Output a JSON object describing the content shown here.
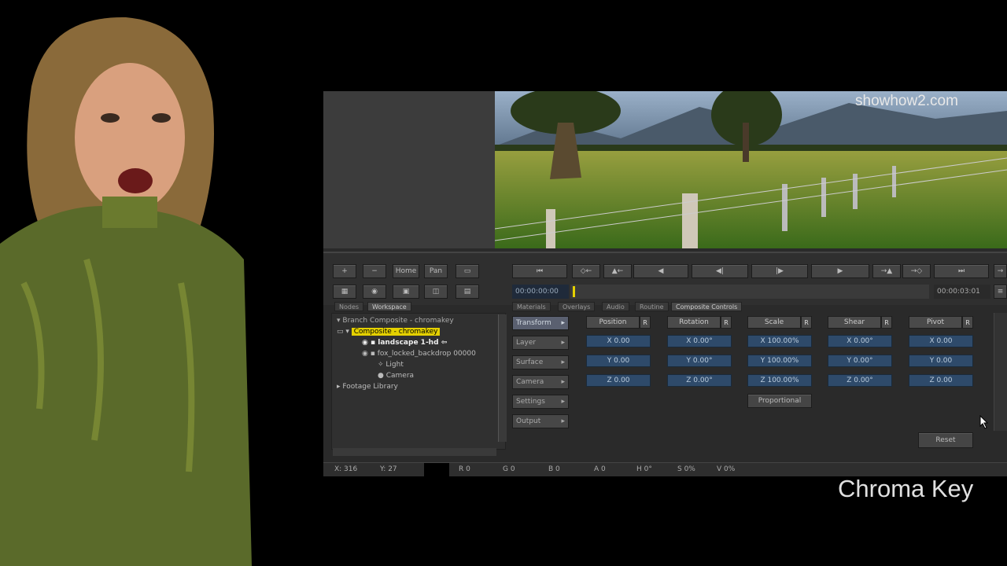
{
  "watermark": "showhow2.com",
  "caption": "Chroma Key",
  "toolbar": {
    "left_buttons": [
      "+",
      "−",
      "Home",
      "Pan"
    ],
    "timecode_start": "00:00:00:00",
    "timecode_end": "00:00:03:01"
  },
  "tabs": {
    "left": [
      "Nodes",
      "Workspace"
    ],
    "right": [
      "Materials",
      "Overlays",
      "Audio",
      "Routine",
      "Composite Controls"
    ]
  },
  "tree": {
    "rows": [
      "Branch Composite - chromakey",
      "Composite - chromakey",
      "landscape 1-hd",
      "fox_locked_backdrop 00000",
      "Light",
      "Camera",
      "Footage Library"
    ]
  },
  "categories": [
    "Transform",
    "Layer",
    "Surface",
    "Camera",
    "Settings",
    "Output"
  ],
  "transform": {
    "columns": [
      {
        "label": "Position",
        "x": "X 0.00",
        "y": "Y 0.00",
        "z": "Z 0.00"
      },
      {
        "label": "Rotation",
        "x": "X 0.00°",
        "y": "Y 0.00°",
        "z": "Z 0.00°"
      },
      {
        "label": "Scale",
        "x": "X 100.00%",
        "y": "Y 100.00%",
        "z": "Z 100.00%"
      },
      {
        "label": "Shear",
        "x": "X 0.00°",
        "y": "Y 0.00°",
        "z": "Z 0.00°"
      },
      {
        "label": "Pivot",
        "x": "X 0.00",
        "y": "Y 0.00",
        "z": "Z 0.00"
      }
    ],
    "reset_label": "R",
    "proportional": "Proportional",
    "reset_button": "Reset"
  },
  "status": {
    "x": "X: 316",
    "y": "Y: 27",
    "r": "R 0",
    "g": "G 0",
    "b": "B 0",
    "a": "A 0",
    "h": "H 0°",
    "s": "S 0%",
    "v": "V 0%"
  },
  "colors": {
    "accent_yellow": "#e4d000",
    "field_blue": "#2e4a6a",
    "panel_dark": "#2a2a2a"
  }
}
